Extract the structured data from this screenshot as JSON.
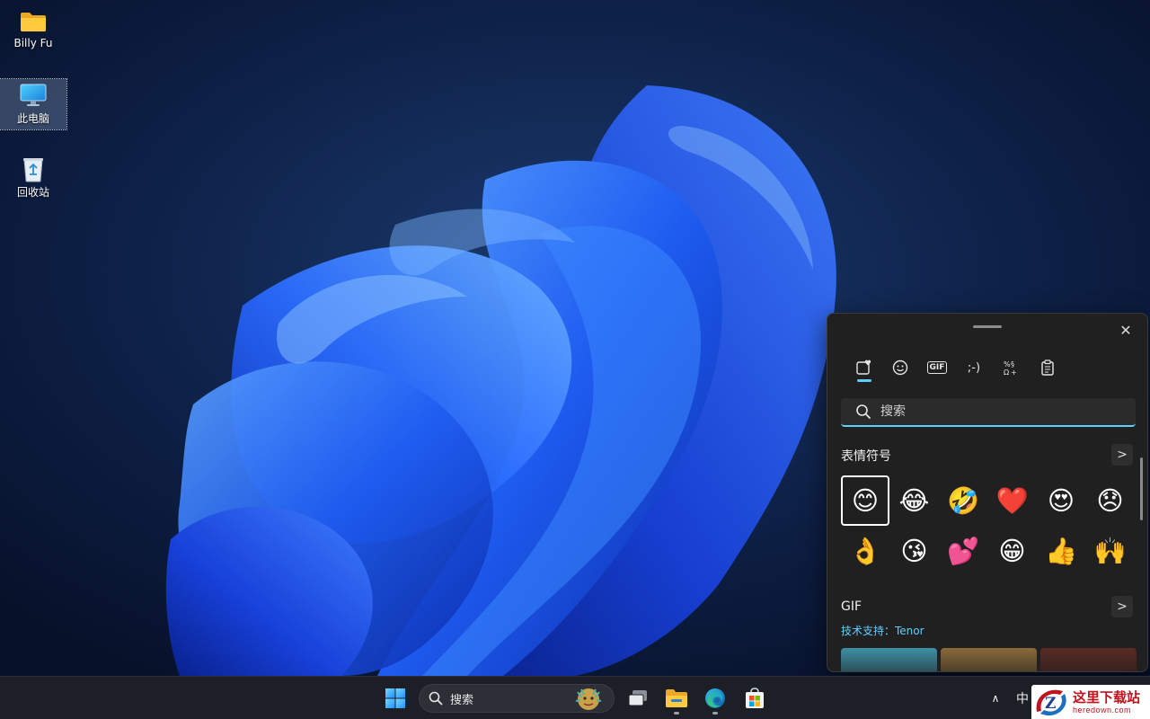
{
  "desktop": {
    "icons": [
      {
        "label": "Billy Fu",
        "icon": "folder-icon"
      },
      {
        "label": "此电脑",
        "icon": "monitor-icon"
      },
      {
        "label": "回收站",
        "icon": "recycle-bin-icon"
      }
    ]
  },
  "emoji_panel": {
    "close_glyph": "✕",
    "tabs": [
      {
        "name": "recently-used-icon"
      },
      {
        "name": "emoji-icon"
      },
      {
        "name": "gif-icon",
        "text": "GIF"
      },
      {
        "name": "kaomoji-icon",
        "text": ";-)"
      },
      {
        "name": "symbols-icon"
      },
      {
        "name": "clipboard-icon"
      }
    ],
    "search_placeholder": "搜索",
    "emoji_section_title": "表情符号",
    "more_glyph": ">",
    "emojis": [
      "😊",
      "😂",
      "🤣",
      "❤️",
      "😍",
      "😞",
      "👌",
      "😘",
      "💕",
      "😁",
      "👍",
      "🙌"
    ],
    "gif_section_title": "GIF",
    "tenor_caption": "技术支持：Tenor",
    "gif_thumbnail_colors": [
      "#3f8fa5",
      "#8a6a3a",
      "#5a2a24"
    ]
  },
  "taskbar": {
    "search_label": "搜索",
    "tray_chevron": "∧",
    "ime_indicator": "中"
  },
  "watermark": {
    "cn": "这里下载站",
    "en": "heredown.com",
    "logo_letter": "Z"
  }
}
